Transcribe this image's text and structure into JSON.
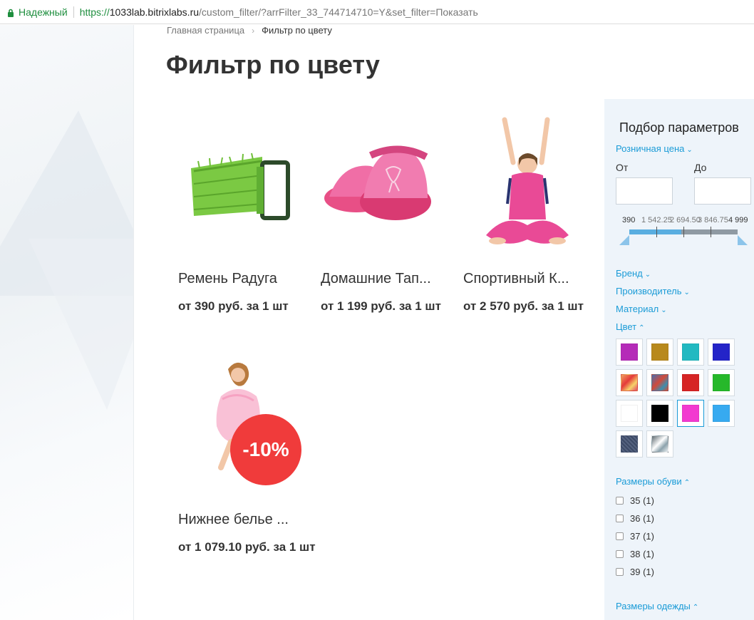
{
  "browser": {
    "secure_label": "Надежный",
    "url_scheme": "https://",
    "url_host": "1033lab.bitrixlabs.ru",
    "url_path": "/custom_filter/?arrFilter_33_744714710=Y&set_filter=Показать"
  },
  "breadcrumb": {
    "home": "Главная страница",
    "current": "Фильтр по цвету"
  },
  "page_title": "Фильтр по цвету",
  "products": [
    {
      "name": "Ремень Радуга",
      "price": "от 390 руб. за 1 шт"
    },
    {
      "name": "Домашние Тап...",
      "price": "от 1 199 руб. за 1 шт"
    },
    {
      "name": "Спортивный К...",
      "price": "от 2 570 руб. за 1 шт"
    },
    {
      "name": "Нижнее белье ...",
      "price": "от 1 079.10 руб. за 1 шт",
      "badge": "-10%"
    }
  ],
  "filter": {
    "title": "Подбор параметров",
    "price": {
      "label": "Розничная цена",
      "from_label": "От",
      "to_label": "До",
      "from_value": "",
      "to_value": "",
      "ticks": [
        "390",
        "1 542.25",
        "2 694.50",
        "3 846.75",
        "4 999"
      ],
      "range_fraction": [
        0.0,
        1.0
      ],
      "selected_fill_fraction": 0.48
    },
    "brand": "Бренд",
    "manufacturer": "Производитель",
    "material": "Материал",
    "color": {
      "label": "Цвет",
      "swatches": [
        {
          "color": "#b52bb8"
        },
        {
          "color": "#b8891c"
        },
        {
          "color": "#22b9c1"
        },
        {
          "color": "#2424c8"
        },
        {
          "color": "pattern-red-orange"
        },
        {
          "color": "pattern-red-blue"
        },
        {
          "color": "#d62424"
        },
        {
          "color": "#26b82a"
        },
        {
          "color": "#ffffff"
        },
        {
          "color": "#000000"
        },
        {
          "color": "#f23ad0",
          "selected": true
        },
        {
          "color": "#37aaf0"
        },
        {
          "color": "pattern-denim"
        },
        {
          "color": "pattern-grey-white"
        }
      ]
    },
    "shoe_sizes": {
      "label": "Размеры обуви",
      "items": [
        "35 (1)",
        "36 (1)",
        "37 (1)",
        "38 (1)",
        "39 (1)"
      ]
    },
    "clothes_sizes": "Размеры одежды"
  }
}
